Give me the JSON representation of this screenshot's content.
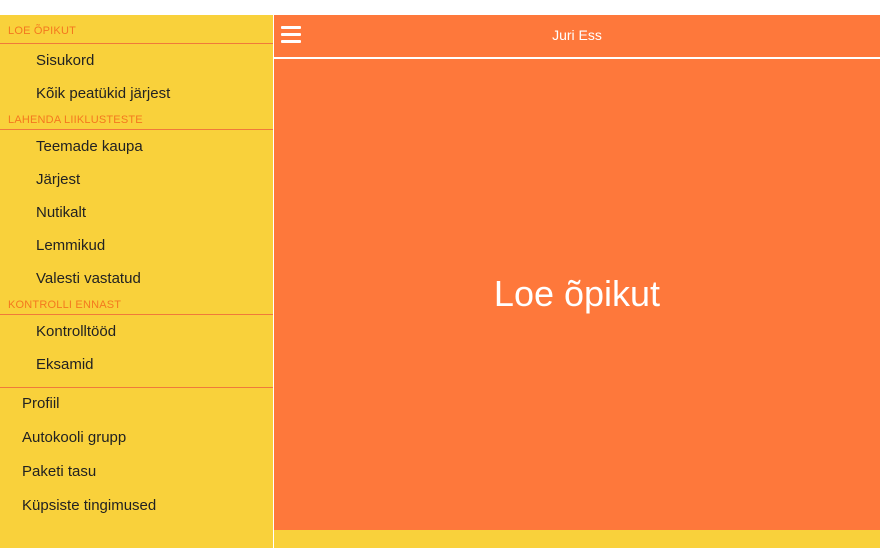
{
  "sidebar": {
    "sections": [
      {
        "header": "LOE ÕPIKUT",
        "items": [
          "Sisukord",
          "Kõik peatükid järjest"
        ]
      },
      {
        "header": "LAHENDA LIIKLUSTESTE",
        "items": [
          "Teemade kaupa",
          "Järjest",
          "Nutikalt",
          "Lemmikud",
          "Valesti vastatud"
        ]
      },
      {
        "header": "KONTROLLI ENNAST",
        "items": [
          "Kontrolltööd",
          "Eksamid"
        ]
      }
    ],
    "top_items": [
      "Profiil",
      "Autokooli grupp",
      "Paketi tasu",
      "Küpsiste tingimused"
    ]
  },
  "header": {
    "user_name": "Juri Ess",
    "menu_icon": "hamburger-menu-icon"
  },
  "main": {
    "title": "Loe õpikut"
  },
  "colors": {
    "accent": "#fe783b",
    "sidebar_bg": "#f9d13b",
    "header_text": "#f4781f"
  }
}
